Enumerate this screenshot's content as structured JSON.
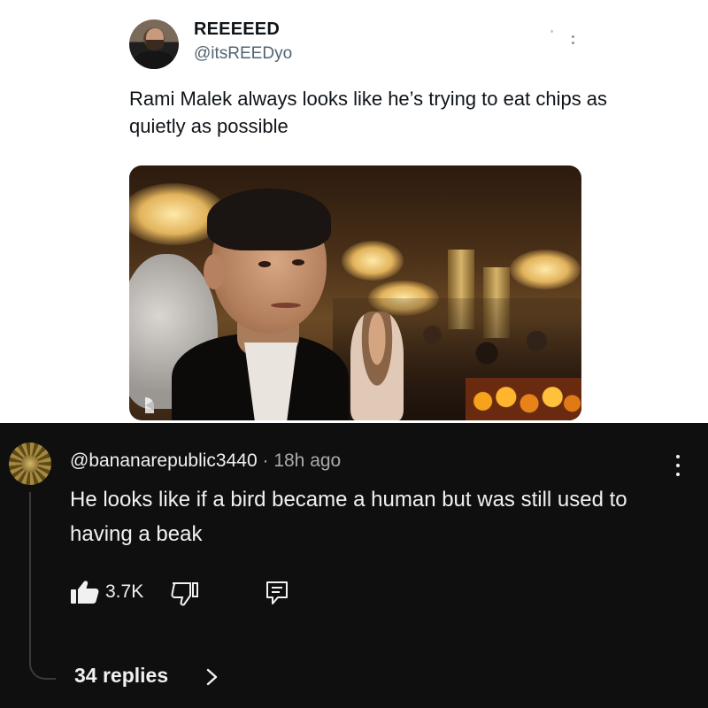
{
  "tweet": {
    "author_name": "REEEEED",
    "author_handle": "@itsREEDyo",
    "text": "Rami Malek always looks like he’s trying to eat chips as quietly as possible",
    "more_icon": "more-dots-icon",
    "media_icon": "tv-network-logo"
  },
  "comment": {
    "handle": "@bananarepublic3440",
    "separator": " · ",
    "time": "18h ago",
    "text": "He looks like if a bird became a human but was still used to having a beak",
    "like_count": "3.7K",
    "like_icon": "thumbs-up-filled-icon",
    "dislike_icon": "thumbs-down-outline-icon",
    "reply_icon": "reply-icon",
    "menu_icon": "kebab-menu-icon",
    "replies_label": "34 replies",
    "replies_chevron": "chevron-right-icon"
  },
  "colors": {
    "tweet_bg": "#ffffff",
    "comment_bg": "#0f0f0f",
    "primary_text_light": "#0f1419",
    "secondary_text_light": "#536471",
    "primary_text_dark": "#f1f1f1",
    "secondary_text_dark": "#aaaaaa"
  }
}
